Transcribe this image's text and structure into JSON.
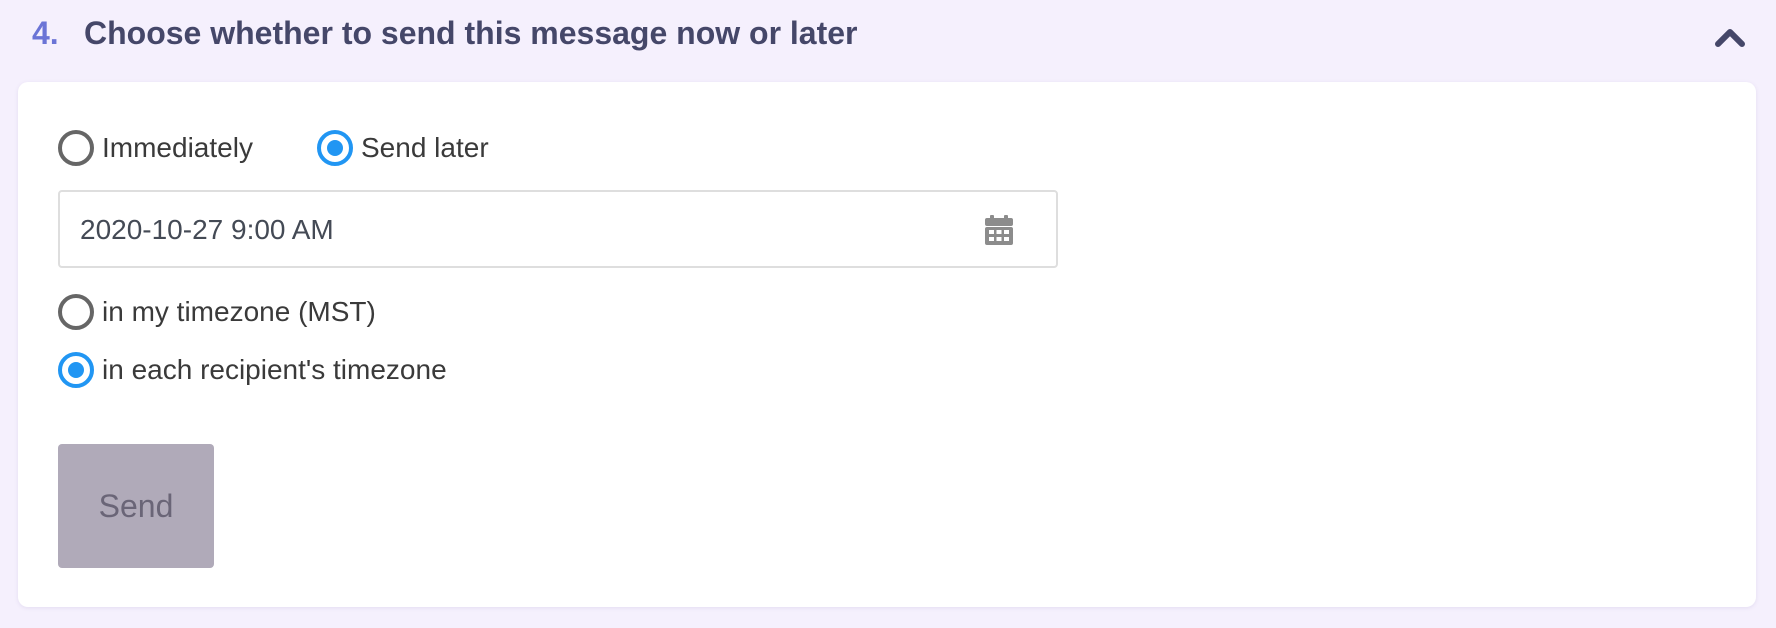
{
  "step": {
    "number": "4.",
    "title": "Choose whether to send this message now or later",
    "collapse_icon": "chevron-up-icon"
  },
  "schedule": {
    "options": [
      {
        "label": "Immediately",
        "checked": false
      },
      {
        "label": "Send later",
        "checked": true
      }
    ],
    "datetime_value": "2020-10-27 9:00 AM",
    "calendar_icon": "calendar-icon"
  },
  "timezone": {
    "options": [
      {
        "label": "in my timezone (MST)",
        "checked": false
      },
      {
        "label": "in each recipient's timezone",
        "checked": true
      }
    ]
  },
  "actions": {
    "send_label": "Send",
    "send_disabled": true
  },
  "colors": {
    "page_background": "#f5f0fd",
    "step_number": "#6b74d6",
    "step_title": "#454769",
    "radio_checked": "#2196f3",
    "radio_unchecked": "#666666",
    "send_button_disabled": "#b0aab9"
  }
}
